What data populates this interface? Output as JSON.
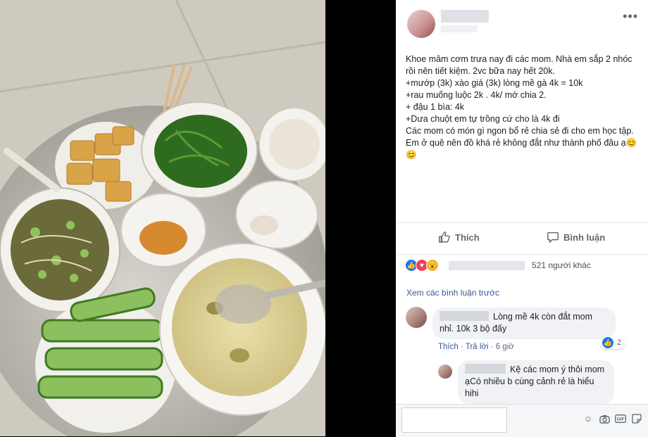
{
  "post": {
    "lines": [
      "Khoe mâm cơm trưa nay đi các mom. Nhà em sắp 2 nhóc rồi nên tiết kiệm. 2vc bữa nay hết 20k.",
      "+mướp (3k) xào giá (3k) lòng mề gà 4k = 10k",
      "+rau muống luộc 2k . 4k/ mớ chia 2.",
      "+ đậu 1 bìa: 4k",
      "+Dưa chuột em tự trồng cứ cho là 4k đi",
      "Các mom có món gì ngon bổ rẻ chia sẻ đi cho em học tập. Em ở quê nên đồ khá rẻ không đắt như thành phố đâu ạ😊😊"
    ]
  },
  "actions": {
    "like": "Thích",
    "comment": "Bình luận"
  },
  "reactions": {
    "others": "521 người khác"
  },
  "comments": {
    "view_previous": "Xem các bình luận trước",
    "items": [
      {
        "text": "Lòng mề 4k còn đắt mom nhỉ. 10k 3 bộ đấy",
        "like": "Thích",
        "reply": "Trả lời",
        "time": "6 giờ",
        "reaction_count": "2"
      },
      {
        "text": "Kệ các mom ý thôi mom ạCó nhiều b cùng cảnh rẻ là hiểu hihi"
      }
    ]
  },
  "icons": {
    "more": "more-options-icon",
    "like": "thumbs-up-icon",
    "comment": "comment-icon",
    "emoji": "emoji-icon",
    "camera": "camera-icon",
    "gif": "gif-icon",
    "sticker": "sticker-icon"
  },
  "colors": {
    "link": "#385898",
    "like_blue": "#1877f2",
    "love_red": "#f33e58",
    "wow_yellow": "#f7b125"
  }
}
